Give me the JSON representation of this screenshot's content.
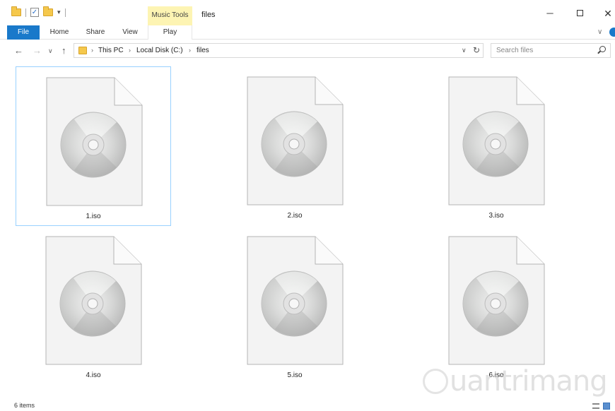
{
  "window": {
    "title": "files",
    "context_tab_label": "Music Tools",
    "minimize_glyph": "─",
    "close_glyph": "✕"
  },
  "ribbon": {
    "tabs": [
      {
        "label": "File"
      },
      {
        "label": "Home"
      },
      {
        "label": "Share"
      },
      {
        "label": "View"
      },
      {
        "label": "Play"
      }
    ]
  },
  "navigation": {
    "back_glyph": "←",
    "forward_glyph": "→",
    "recent_glyph": "∨",
    "up_glyph": "↑",
    "breadcrumb": [
      "This PC",
      "Local Disk (C:)",
      "files"
    ],
    "separator": "›",
    "search_placeholder": "Search files"
  },
  "files": [
    {
      "name": "1.iso",
      "selected": true
    },
    {
      "name": "2.iso",
      "selected": false
    },
    {
      "name": "3.iso",
      "selected": false
    },
    {
      "name": "4.iso",
      "selected": false
    },
    {
      "name": "5.iso",
      "selected": false
    },
    {
      "name": "6.iso",
      "selected": false
    }
  ],
  "status": {
    "item_count": "6 items"
  },
  "watermark": "uantrimang",
  "colors": {
    "accent": "#1979ca",
    "context_tab": "#fdf4b3",
    "selection_border": "#99d1ff"
  }
}
